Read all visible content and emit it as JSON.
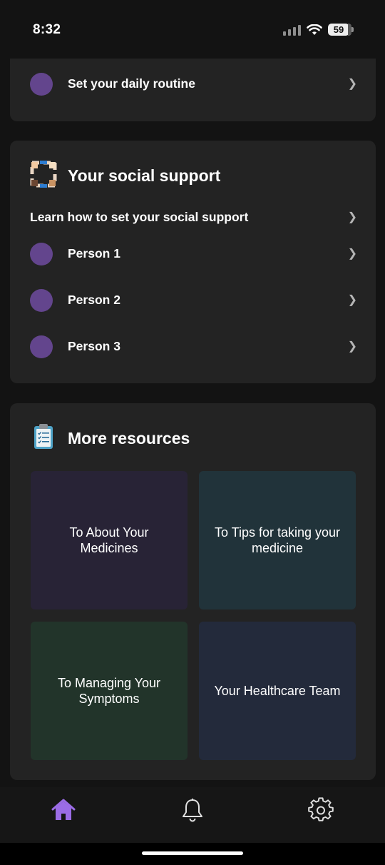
{
  "status_bar": {
    "time": "8:32",
    "battery": "59"
  },
  "routine_card": {
    "item_label": "Set your daily routine",
    "chevron": "❯"
  },
  "social_card": {
    "title": "Your social support",
    "learn_label": "Learn how to set your social support",
    "chevron": "❯",
    "people": [
      "Person 1",
      "Person 2",
      "Person 3"
    ]
  },
  "resources_card": {
    "title": "More resources",
    "tiles": [
      {
        "label": "To About Your Medicines",
        "color": "#282336"
      },
      {
        "label": "To Tips for taking your medicine",
        "color": "#21333a"
      },
      {
        "label": "To Managing Your Symptoms",
        "color": "#22342a"
      },
      {
        "label": "Your Healthcare Team",
        "color": "#232a3b"
      }
    ]
  },
  "nav": {
    "items": [
      {
        "name": "home-icon",
        "active": true
      },
      {
        "name": "bell-icon",
        "active": false
      },
      {
        "name": "gear-icon",
        "active": false
      }
    ],
    "active_color": "#9b6ce6"
  },
  "colors": {
    "accent_dot": "#63458d",
    "card_bg": "#232323",
    "page_bg": "#131313"
  }
}
